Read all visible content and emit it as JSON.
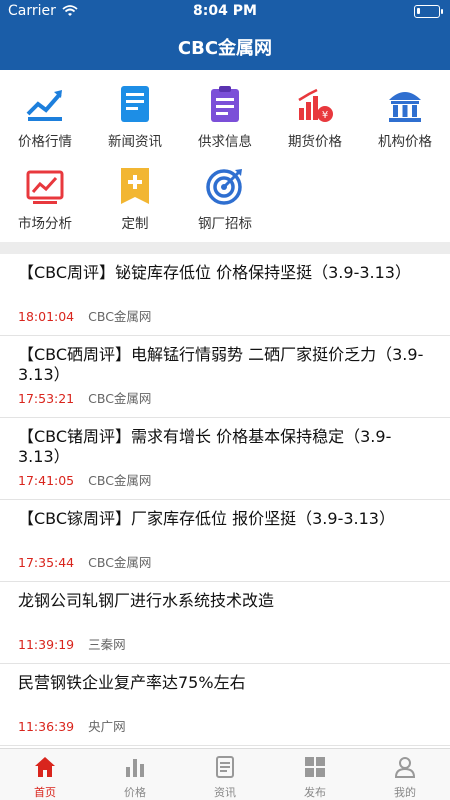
{
  "status_bar": {
    "carrier": "Carrier",
    "time": "8:04 PM"
  },
  "nav": {
    "title": "CBC金属网"
  },
  "menu": [
    {
      "label": "价格行情",
      "icon": "price-trend-icon"
    },
    {
      "label": "新闻资讯",
      "icon": "news-document-icon"
    },
    {
      "label": "供求信息",
      "icon": "clipboard-icon"
    },
    {
      "label": "期货价格",
      "icon": "futures-chart-icon"
    },
    {
      "label": "机构价格",
      "icon": "institution-building-icon"
    },
    {
      "label": "市场分析",
      "icon": "market-analysis-icon"
    },
    {
      "label": "定制",
      "icon": "custom-plus-icon"
    },
    {
      "label": "钢厂招标",
      "icon": "target-icon"
    }
  ],
  "news": [
    {
      "title": "【CBC周评】铋锭库存低位 价格保持坚挺（3.9-3.13）",
      "time": "18:01:04",
      "source": "CBC金属网"
    },
    {
      "title": "【CBC硒周评】电解锰行情弱势 二硒厂家挺价乏力（3.9-3.13）",
      "time": "17:53:21",
      "source": "CBC金属网"
    },
    {
      "title": "【CBC锗周评】需求有增长 价格基本保持稳定（3.9-3.13）",
      "time": "17:41:05",
      "source": "CBC金属网"
    },
    {
      "title": "【CBC镓周评】厂家库存低位 报价坚挺（3.9-3.13）",
      "time": "17:35:44",
      "source": "CBC金属网"
    },
    {
      "title": "龙钢公司轧钢厂进行水系统技术改造",
      "time": "11:39:19",
      "source": "三秦网"
    },
    {
      "title": "民营钢铁企业复产率达75%左右",
      "time": "11:36:39",
      "source": "央广网"
    }
  ],
  "tabs": [
    {
      "label": "首页",
      "icon": "home-icon"
    },
    {
      "label": "价格",
      "icon": "bar-chart-icon"
    },
    {
      "label": "资讯",
      "icon": "news-icon"
    },
    {
      "label": "发布",
      "icon": "grid-icon"
    },
    {
      "label": "我的",
      "icon": "user-icon"
    }
  ],
  "colors": {
    "header": "#1a5da8",
    "accent": "#d9251d"
  }
}
